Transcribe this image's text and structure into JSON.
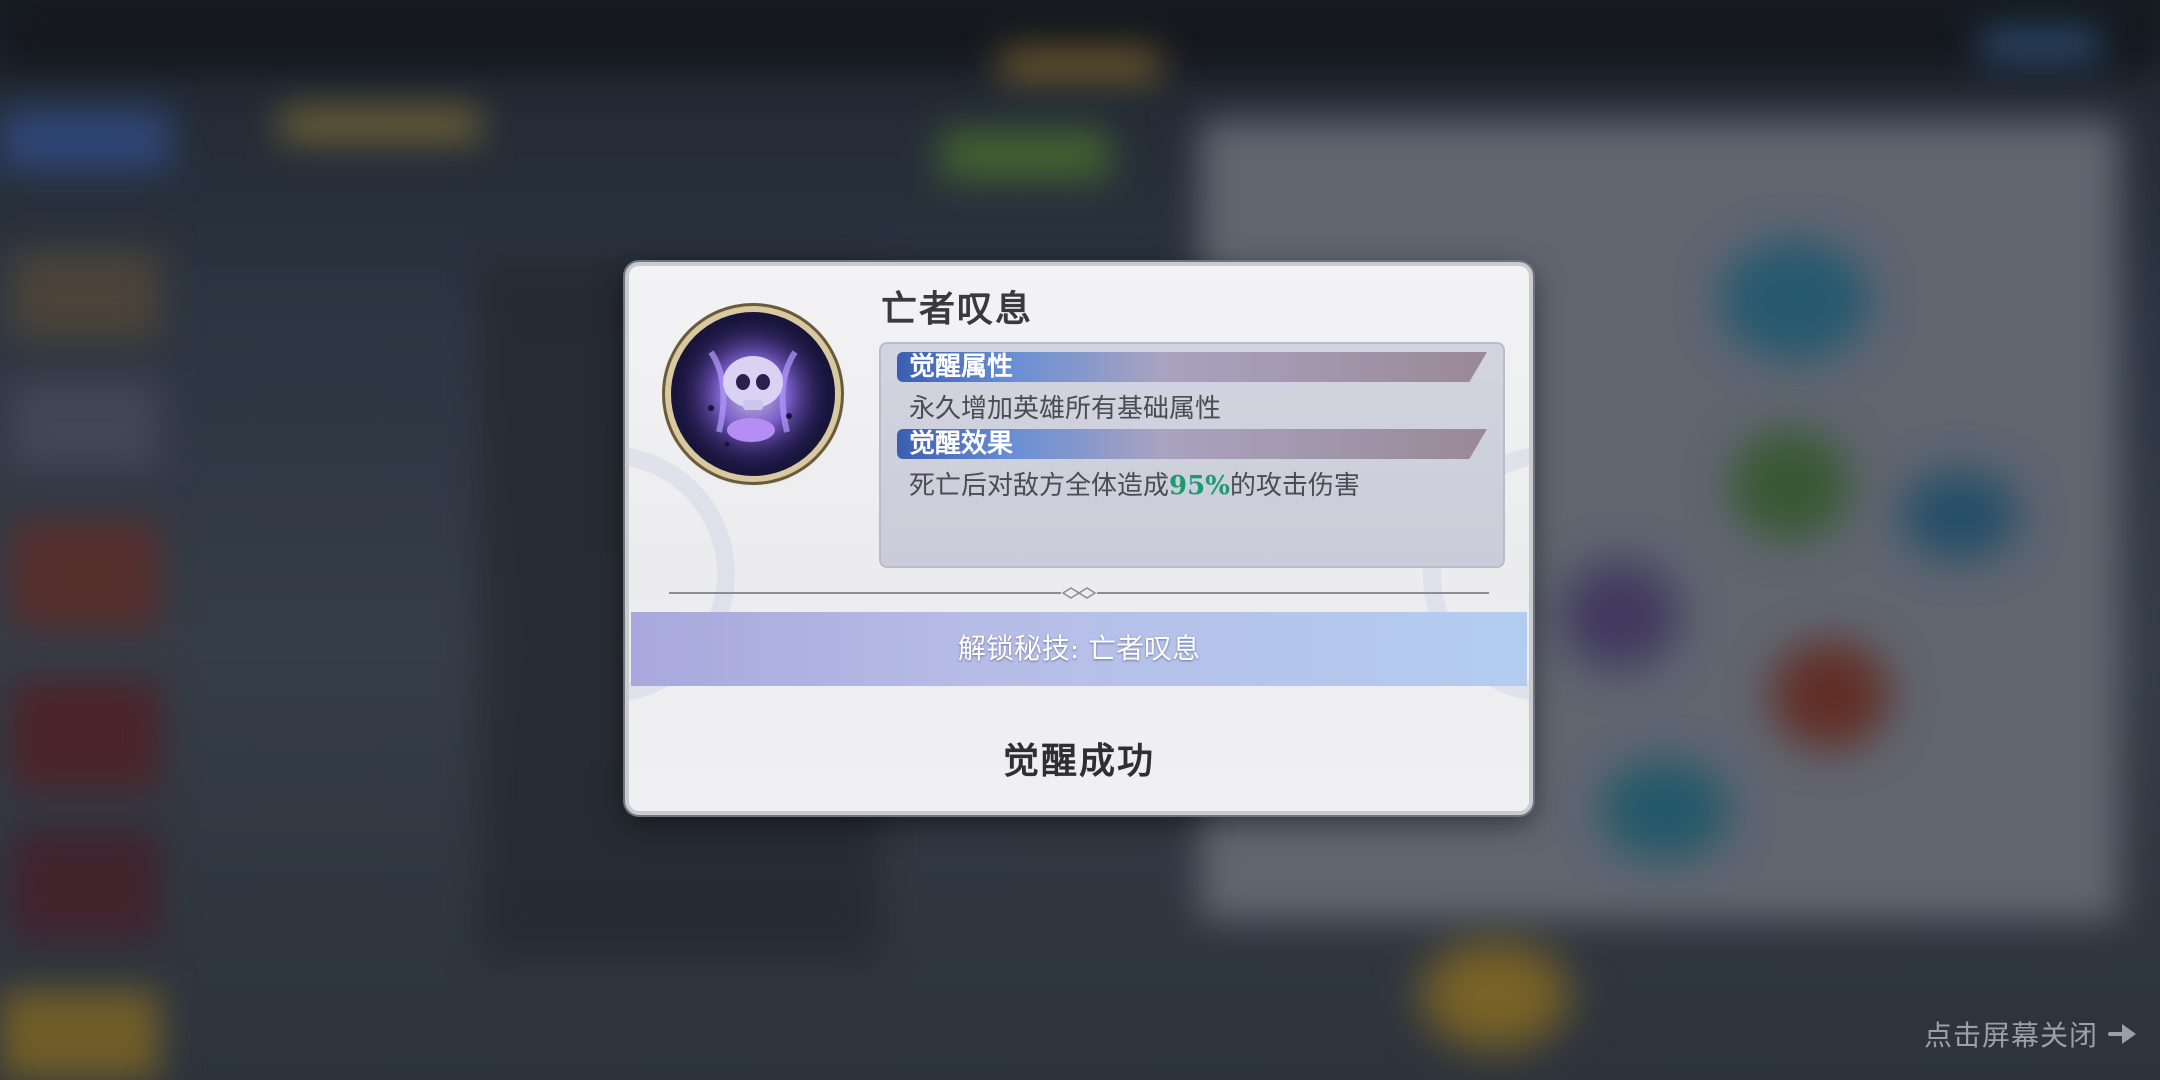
{
  "modal": {
    "skill_name": "亡者叹息",
    "sections": [
      {
        "tag": "觉醒属性",
        "text": "永久增加英雄所有基础属性"
      },
      {
        "tag": "觉醒效果",
        "text_before": "死亡后对敌方全体造成",
        "highlight": "95%",
        "text_after": "的攻击伤害"
      }
    ],
    "unlock_text": "解锁秘技: 亡者叹息",
    "result_text": "觉醒成功"
  },
  "close_hint": {
    "label": "点击屏幕关闭",
    "icon": "arrow-right-icon"
  },
  "colors": {
    "highlight": "#1f9a6f",
    "tag_blue": "#3b5fb0",
    "unlock_bar": "#b6bde6"
  }
}
